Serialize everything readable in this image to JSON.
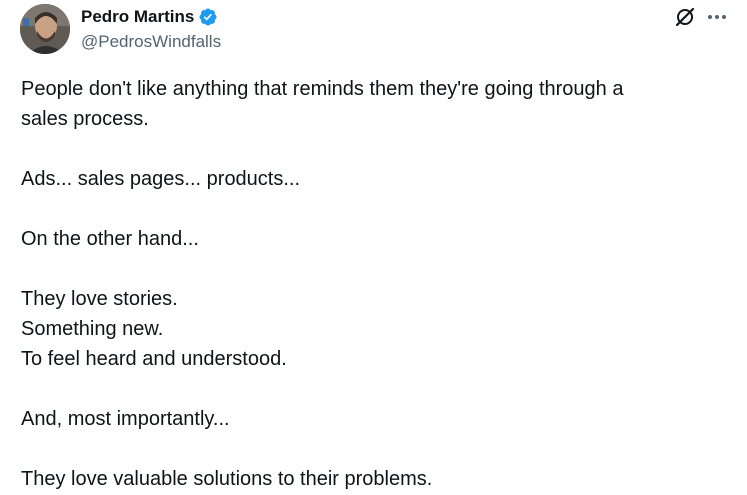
{
  "author": {
    "display_name": "Pedro Martins",
    "handle": "@PedrosWindfalls",
    "verified": true
  },
  "icons": {
    "verified": "verified-badge-icon",
    "grok": "grok-icon",
    "more": "more-options-icon"
  },
  "colors": {
    "verified_blue": "#1d9bf0",
    "text_primary": "#0f1419",
    "text_secondary": "#536471"
  },
  "tweet": {
    "lines": [
      "People don't like anything that reminds them they're going through a",
      "sales process.",
      "Ads... sales pages... products...",
      "On the other hand...",
      "They love stories.",
      "Something new.",
      "To feel heard and understood.",
      "And, most importantly...",
      "They love valuable solutions to their problems."
    ]
  }
}
